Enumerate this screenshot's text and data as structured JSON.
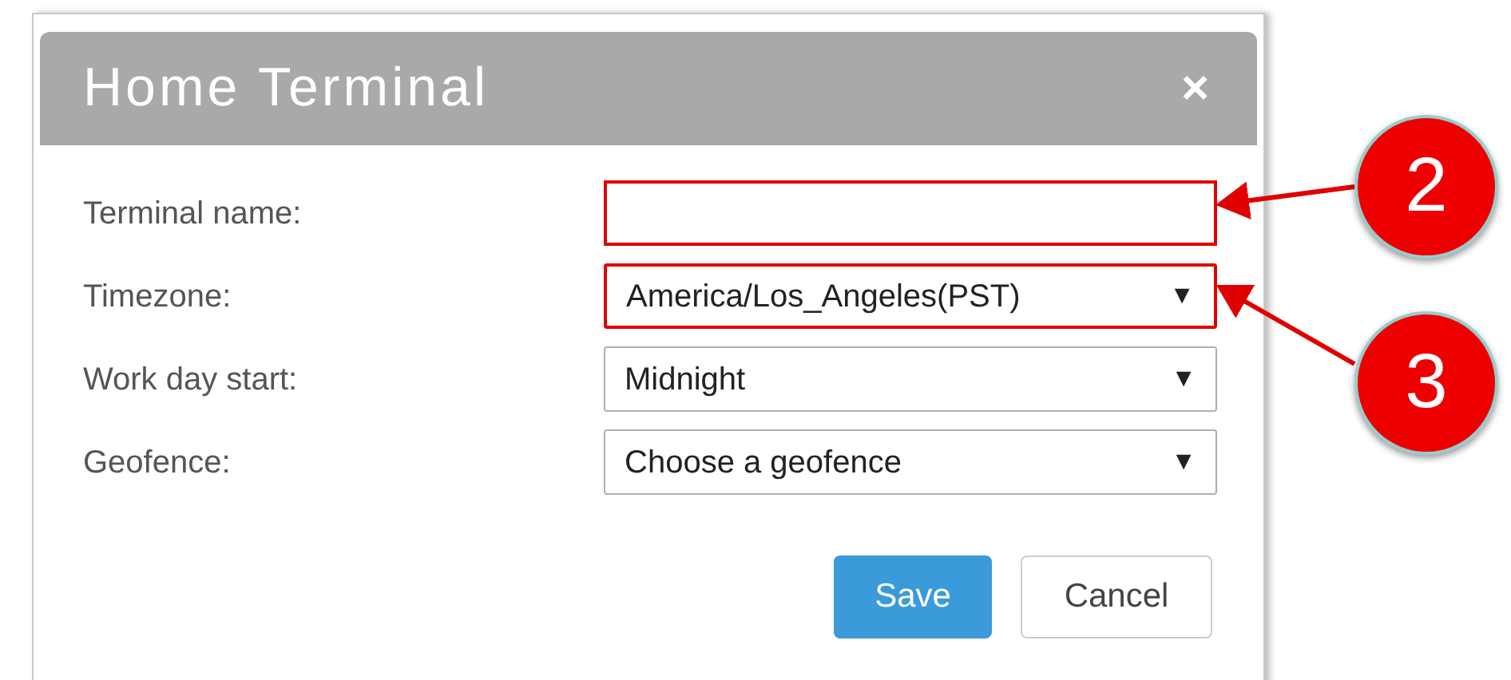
{
  "dialog": {
    "title": "Home Terminal",
    "close": "×"
  },
  "fields": [
    {
      "kind": "input",
      "label": "Terminal name:",
      "highlighted": true
    },
    {
      "kind": "select",
      "label": "Timezone:",
      "value": "America/Los_Angeles(PST)",
      "caret": "▼",
      "highlighted": true
    },
    {
      "kind": "select",
      "label": "Work day start:",
      "value": "Midnight",
      "caret": "▼",
      "highlighted": false
    },
    {
      "kind": "select",
      "label": "Geofence:",
      "value": "Choose a geofence",
      "caret": "▼",
      "highlighted": false
    }
  ],
  "buttons": [
    {
      "label": "Save",
      "kind": "primary"
    },
    {
      "label": "Cancel",
      "kind": "default"
    }
  ],
  "callouts": [
    {
      "number": "2"
    },
    {
      "number": "3"
    }
  ]
}
